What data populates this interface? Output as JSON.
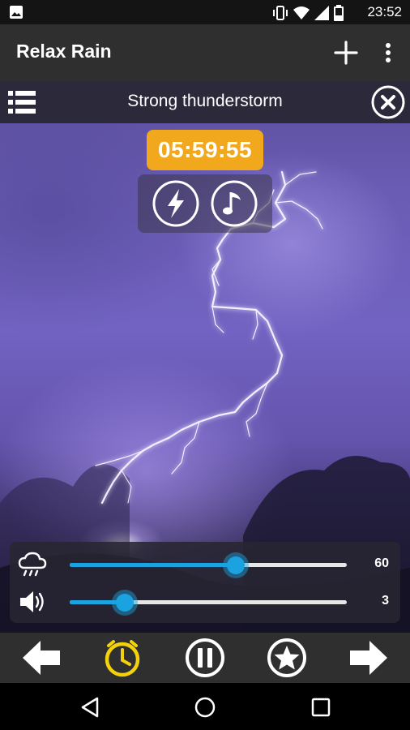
{
  "status_bar": {
    "time": "23:52",
    "icons": [
      "image-icon",
      "vibrate-icon",
      "wifi-icon",
      "signal-icon",
      "battery-icon"
    ]
  },
  "app_bar": {
    "title": "Relax Rain",
    "actions": [
      "add-icon",
      "more-vert-icon"
    ]
  },
  "player": {
    "track_title": "Strong thunderstorm",
    "timer": "05:59:55",
    "modes": [
      "lightning-icon",
      "music-note-icon"
    ]
  },
  "sliders": [
    {
      "name": "rain",
      "icon": "rain-cloud-icon",
      "value_label": "60",
      "fraction": 0.6
    },
    {
      "name": "volume",
      "icon": "speaker-icon",
      "value_label": "3",
      "fraction": 0.2
    }
  ],
  "controls": {
    "items": [
      "arrow-left-icon",
      "timer-icon",
      "pause-icon",
      "star-icon",
      "arrow-right-icon"
    ],
    "accent_color": "#f4d20a"
  },
  "colors": {
    "timer_bg": "#f2a81c",
    "slider_accent": "#1aa3e0",
    "bar_bg": "#2f2f2f"
  },
  "nav_bar": [
    "back-icon",
    "home-icon",
    "recents-icon"
  ]
}
